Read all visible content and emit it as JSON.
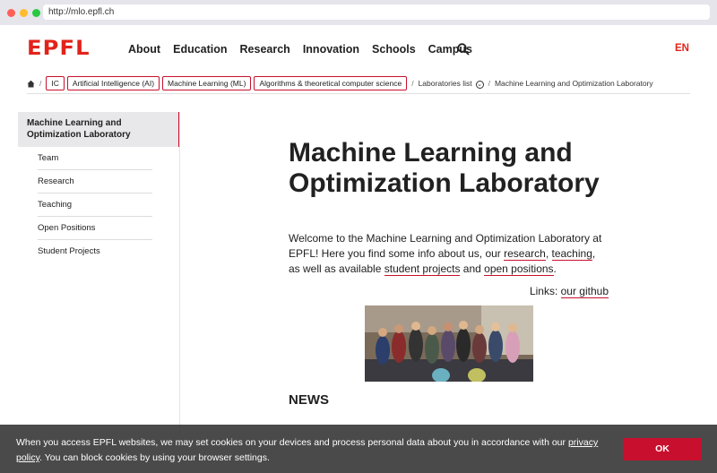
{
  "browser": {
    "url": "http://mlo.epfl.ch"
  },
  "header": {
    "logo": "EPFL",
    "nav": [
      "About",
      "Education",
      "Research",
      "Innovation",
      "Schools",
      "Campus"
    ],
    "lang": "EN"
  },
  "breadcrumb": {
    "items": [
      "IC",
      "Artificial Intelligence (AI)",
      "Machine Learning (ML)",
      "Algorithms & theoretical computer science"
    ],
    "labs_list": "Laboratories list",
    "current": "Machine Learning and Optimization Laboratory"
  },
  "sidebar": {
    "title": "Machine Learning and Optimization Laboratory",
    "items": [
      "Team",
      "Research",
      "Teaching",
      "Open Positions",
      "Student Projects"
    ]
  },
  "main": {
    "title": "Machine Learning and Optimization Laboratory",
    "intro_1": "Welcome to the Machine Learning and Optimization Laboratory at EPFL! Here you find some info about us, our ",
    "link_research": "research",
    "intro_2": ", ",
    "link_teaching": "teaching",
    "intro_3": ", as well as available ",
    "link_student_projects": "student projects",
    "intro_4": " and ",
    "link_open_positions": "open positions",
    "intro_5": ".",
    "links_label": "Links: ",
    "link_github": "our github",
    "news_heading": "NEWS"
  },
  "cookie": {
    "text_1": "When you access EPFL websites, we may set cookies on your devices and process personal data about you in accordance with our ",
    "privacy_link": "privacy policy",
    "text_2": ". You can block cookies by using your browser settings.",
    "ok": "OK"
  },
  "colors": {
    "accent": "#c8102e",
    "logo": "#e2231a"
  }
}
